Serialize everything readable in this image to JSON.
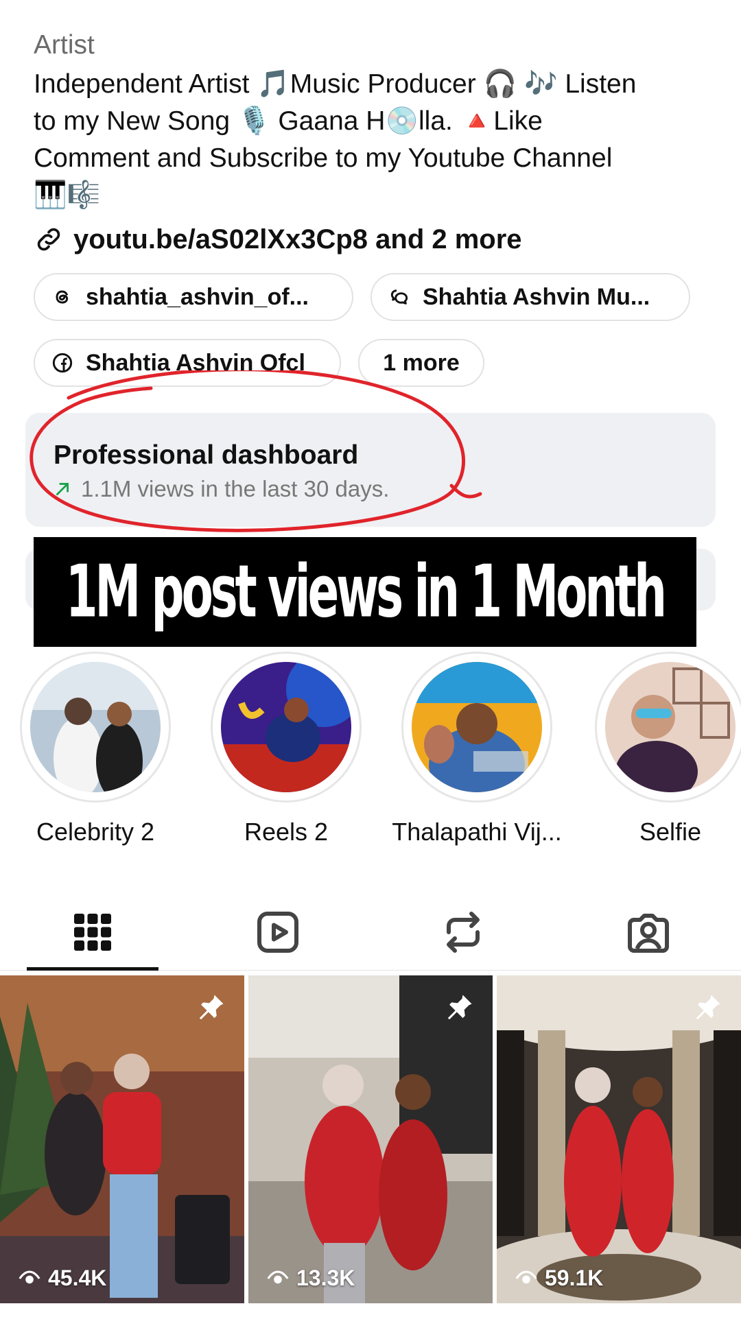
{
  "profile": {
    "category": "Artist",
    "bio_line1": "Independent Artist 🎵Music Producer 🎧 🎶 Listen",
    "bio_line2": "to my New Song 🎙️ Gaana H💿lla. 🔺Like",
    "bio_line3": "Comment and Subscribe to my Youtube Channel",
    "bio_line4": "🎹🎼",
    "link_text": "youtu.be/aS02lXx3Cp8 and 2 more"
  },
  "chips": [
    {
      "label": "shahtia_ashvin_of...",
      "icon": "threads-icon"
    },
    {
      "label": "Shahtia Ashvin Mu...",
      "icon": "chat-icon"
    },
    {
      "label": "Shahtia Ashvin Ofcl",
      "icon": "facebook-icon"
    },
    {
      "label": "1 more",
      "icon": ""
    }
  ],
  "dashboard": {
    "title": "Professional dashboard",
    "subtitle": "1.1M views in the last 30 days."
  },
  "banner": {
    "text": "1M post views in 1 Month"
  },
  "highlights": [
    {
      "label": "Celebrity 2"
    },
    {
      "label": "Reels 2"
    },
    {
      "label": "Thalapathi Vij..."
    },
    {
      "label": "Selfie"
    }
  ],
  "tabs": [
    "grid-icon",
    "reels-icon",
    "reposts-icon",
    "tagged-icon"
  ],
  "posts": [
    {
      "views": "45.4K",
      "pinned": true
    },
    {
      "views": "13.3K",
      "pinned": true
    },
    {
      "views": "59.1K",
      "pinned": true
    }
  ],
  "colors": {
    "annotation_red": "#e0242b",
    "dashboard_bg": "#eff0f3",
    "muted_text": "#6b6b6b"
  }
}
